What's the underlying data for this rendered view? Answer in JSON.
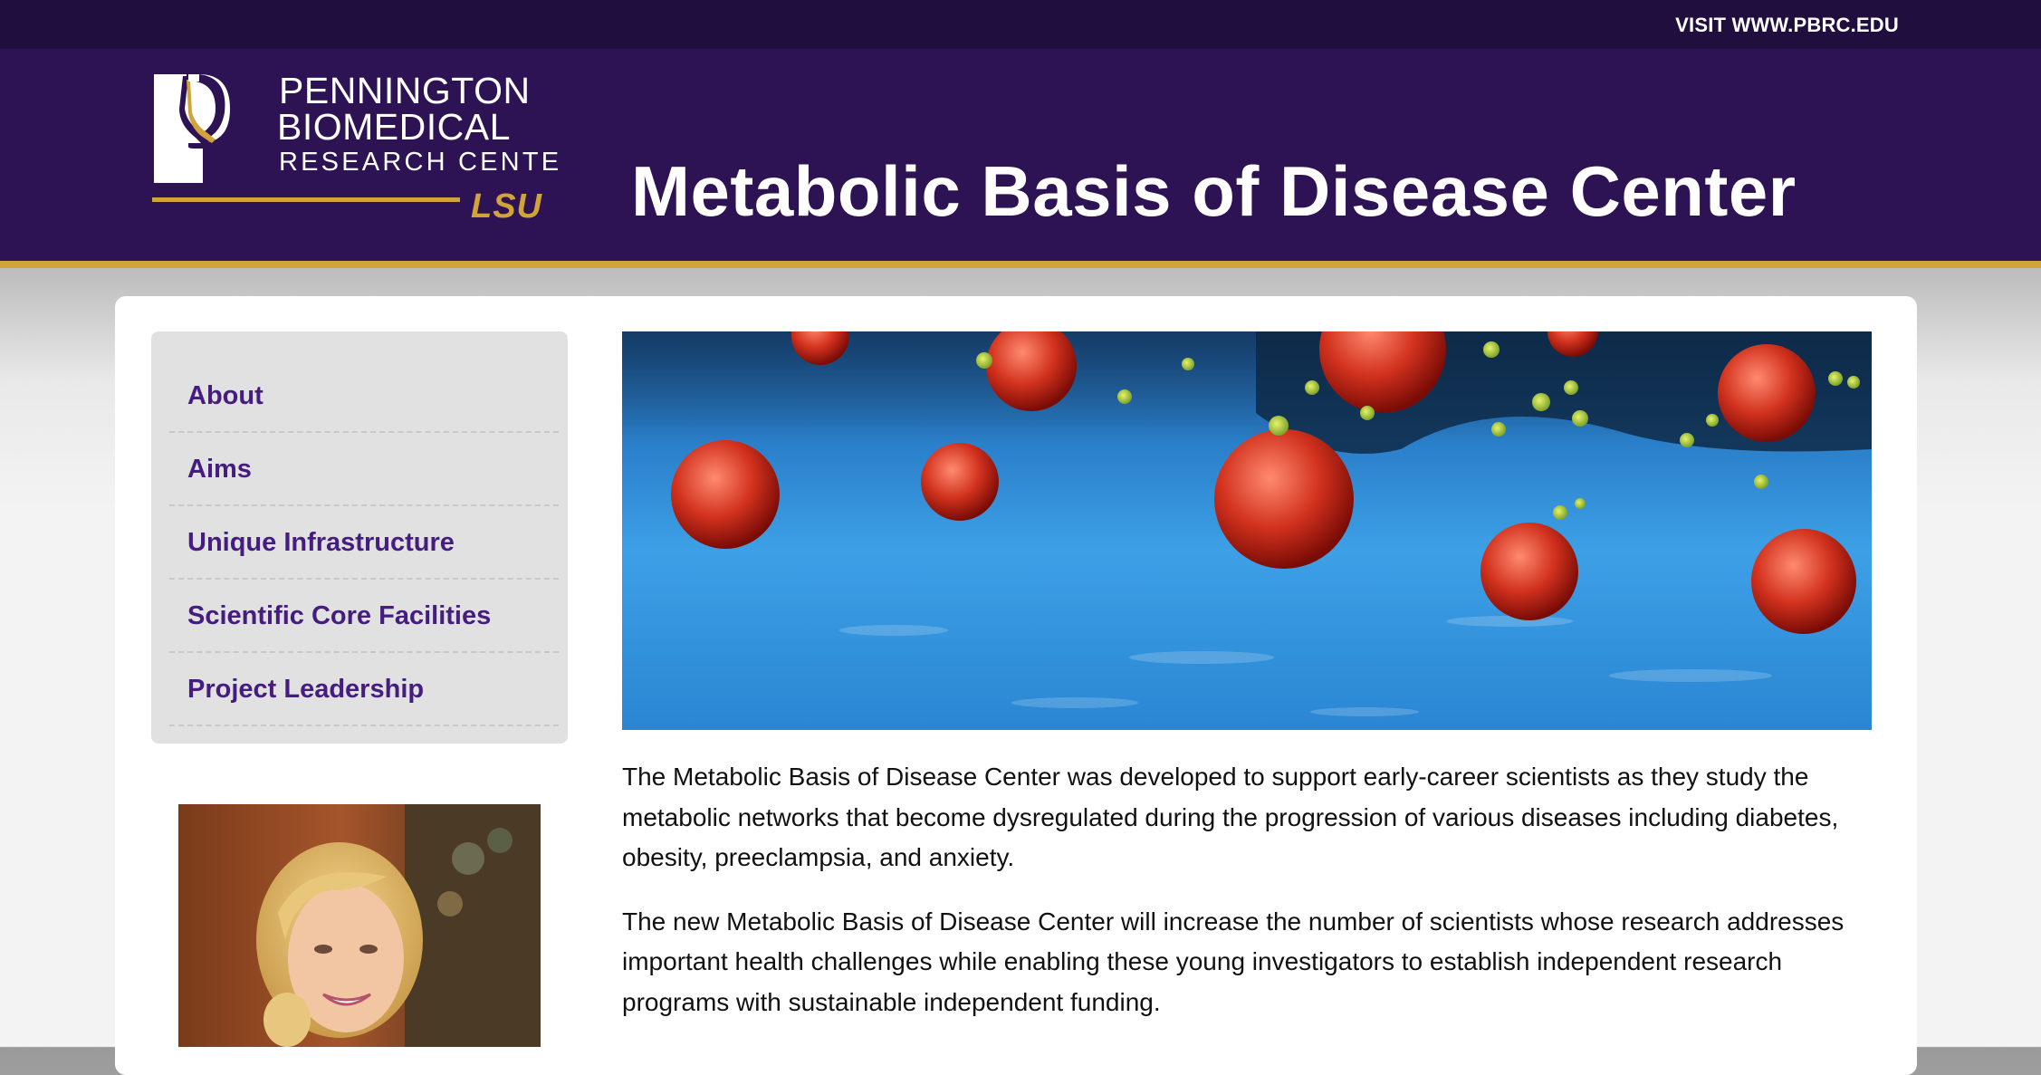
{
  "topbar": {
    "link_label": "VISIT WWW.PBRC.EDU"
  },
  "header": {
    "logo": {
      "line1": "PENNINGTON",
      "line2": "BIOMEDICAL",
      "line3": "RESEARCH CENTER",
      "line4": "LSU"
    },
    "title": "Metabolic Basis of Disease Center"
  },
  "sidebar": {
    "items": [
      {
        "label": "About"
      },
      {
        "label": "Aims"
      },
      {
        "label": "Unique Infrastructure"
      },
      {
        "label": "Scientific Core Facilities"
      },
      {
        "label": "Project Leadership"
      }
    ]
  },
  "main": {
    "paragraphs": [
      "The Metabolic Basis of Disease Center was developed to support early-career scientists as they study the metabolic networks that become dysregulated during the progression of various diseases including diabetes, obesity, preeclampsia, and anxiety.",
      "The new Metabolic Basis of Disease Center will increase the number of scientists whose research addresses important health challenges while enabling these young investigators to establish independent research programs with sustainable independent funding."
    ]
  },
  "colors": {
    "topbar": "#200e3f",
    "header": "#2d1353",
    "gold": "#d1a43a",
    "nav_link": "#451c7f"
  },
  "icons": [
    "pbrc-logo-icon",
    "lsu-wordmark",
    "hero-cells-image",
    "director-portrait"
  ]
}
